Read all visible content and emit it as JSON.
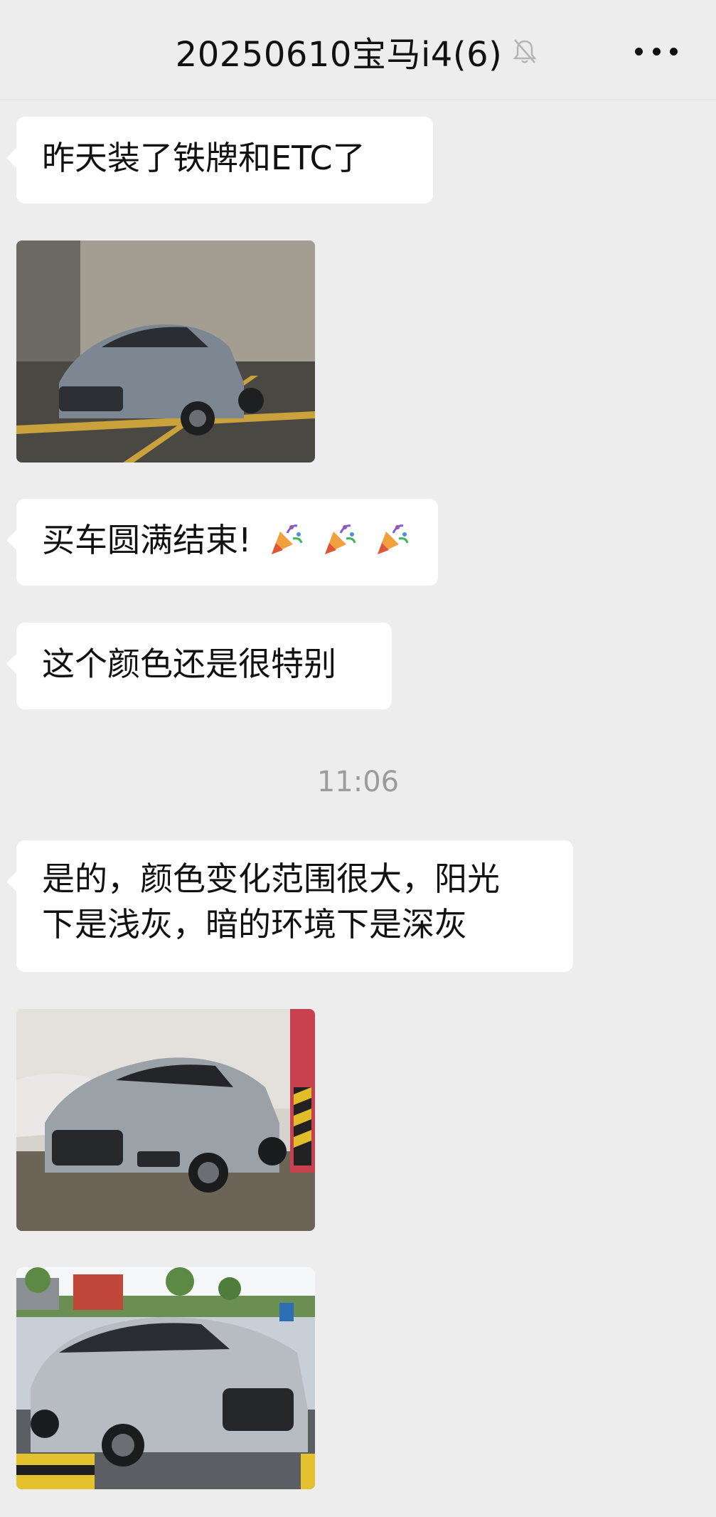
{
  "header": {
    "title": "20250610宝马i4(6)",
    "mute_icon": "bell-muted-icon",
    "more_icon": "more-dots-icon"
  },
  "messages": [
    {
      "type": "text",
      "text": "昨天装了铁牌和ETC了"
    },
    {
      "type": "image",
      "subject": "car-photo-garage-1"
    },
    {
      "type": "text",
      "text": "买车圆满结束!",
      "emoji": [
        "party-popper-icon",
        "party-popper-icon",
        "party-popper-icon"
      ]
    },
    {
      "type": "text",
      "text": "这个颜色还是很特别"
    },
    {
      "type": "time",
      "text": "11:06"
    },
    {
      "type": "text",
      "lines": [
        "是的，颜色变化范围很大，阳光",
        "下是浅灰，暗的环境下是深灰"
      ]
    },
    {
      "type": "image",
      "subject": "car-photo-garage-2"
    },
    {
      "type": "image",
      "subject": "car-photo-outdoor"
    }
  ],
  "colors": {
    "background": "#ededed",
    "bubble": "#ffffff",
    "timestamp": "#9b9b9b"
  }
}
